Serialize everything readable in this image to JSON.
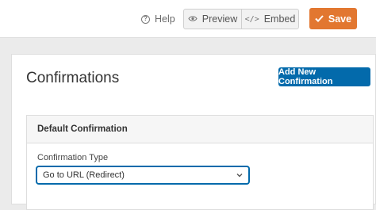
{
  "toolbar": {
    "help_label": "Help",
    "help_icon_glyph": "?",
    "preview_label": "Preview",
    "embed_label": "Embed",
    "embed_icon_glyph": "</>",
    "save_label": "Save"
  },
  "page": {
    "title": "Confirmations",
    "add_button_label": "Add New Confirmation"
  },
  "confirmation_card": {
    "header": "Default Confirmation",
    "type_label": "Confirmation Type",
    "type_value": "Go to URL (Redirect)"
  },
  "colors": {
    "save_orange": "#e27730",
    "primary_blue": "#036aab"
  },
  "icons": [
    "help-icon",
    "eye-icon",
    "code-icon",
    "checkmark-icon",
    "chevron-down-icon"
  ]
}
